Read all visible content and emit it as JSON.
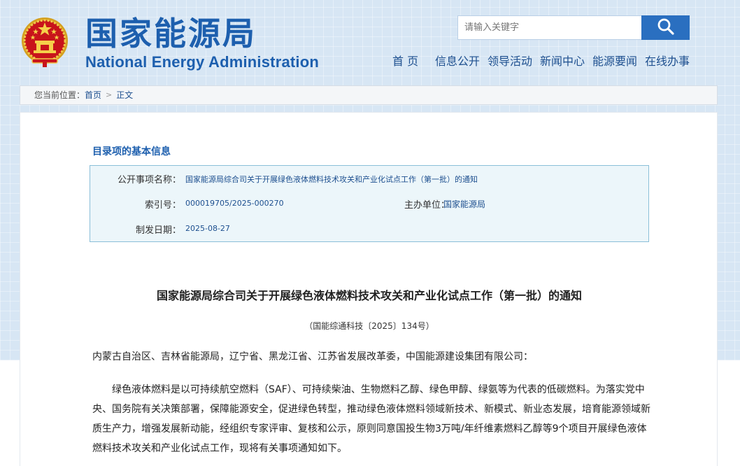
{
  "header": {
    "logo_cn": "国家能源局",
    "logo_en": "National Energy Administration",
    "search_placeholder": "请输入关键字"
  },
  "nav": {
    "items": [
      "首 页",
      "信息公开",
      "领导活动",
      "新闻中心",
      "能源要闻",
      "在线办事"
    ]
  },
  "breadcrumb": {
    "prefix": "您当前位置：",
    "home": "首页",
    "current": "正文"
  },
  "info": {
    "section_title": "目录项的基本信息",
    "item_name_label": "公开事项名称：",
    "item_name_value": "国家能源局综合司关于开展绿色液体燃料技术攻关和产业化试点工作（第一批）的通知",
    "index_label": "索引号：",
    "index_value": "000019705/2025-000270",
    "org_label": "主办单位：",
    "org_value": "国家能源局",
    "date_label": "制发日期：",
    "date_value": "2025-08-27"
  },
  "document": {
    "title": "国家能源局综合司关于开展绿色液体燃料技术攻关和产业化试点工作（第一批）的通知",
    "number": "（国能综通科技〔2025〕134号）",
    "addressee": "内蒙古自治区、吉林省能源局，辽宁省、黑龙江省、江苏省发展改革委，中国能源建设集团有限公司：",
    "paragraph1": "绿色液体燃料是以可持续航空燃料（SAF）、可持续柴油、生物燃料乙醇、绿色甲醇、绿氨等为代表的低碳燃料。为落实党中央、国务院有关决策部署，保障能源安全，促进绿色转型，推动绿色液体燃料领域新技术、新模式、新业态发展，培育能源领域新质生产力，增强发展新动能，经组织专家评审、复核和公示，原则同意国投生物3万吨/年纤维素燃料乙醇等9个项目开展绿色液体燃料技术攻关和产业化试点工作，现将有关事项通知如下。"
  },
  "colors": {
    "brand_blue": "#1d5fae",
    "search_button": "#2a6fc0",
    "info_box_border": "#8bbfd8",
    "info_box_bg": "#ecf6fa"
  },
  "icons": {
    "emblem": "national-emblem-icon",
    "search": "search-icon",
    "breadcrumb_separator": "chevron-right-icon"
  }
}
